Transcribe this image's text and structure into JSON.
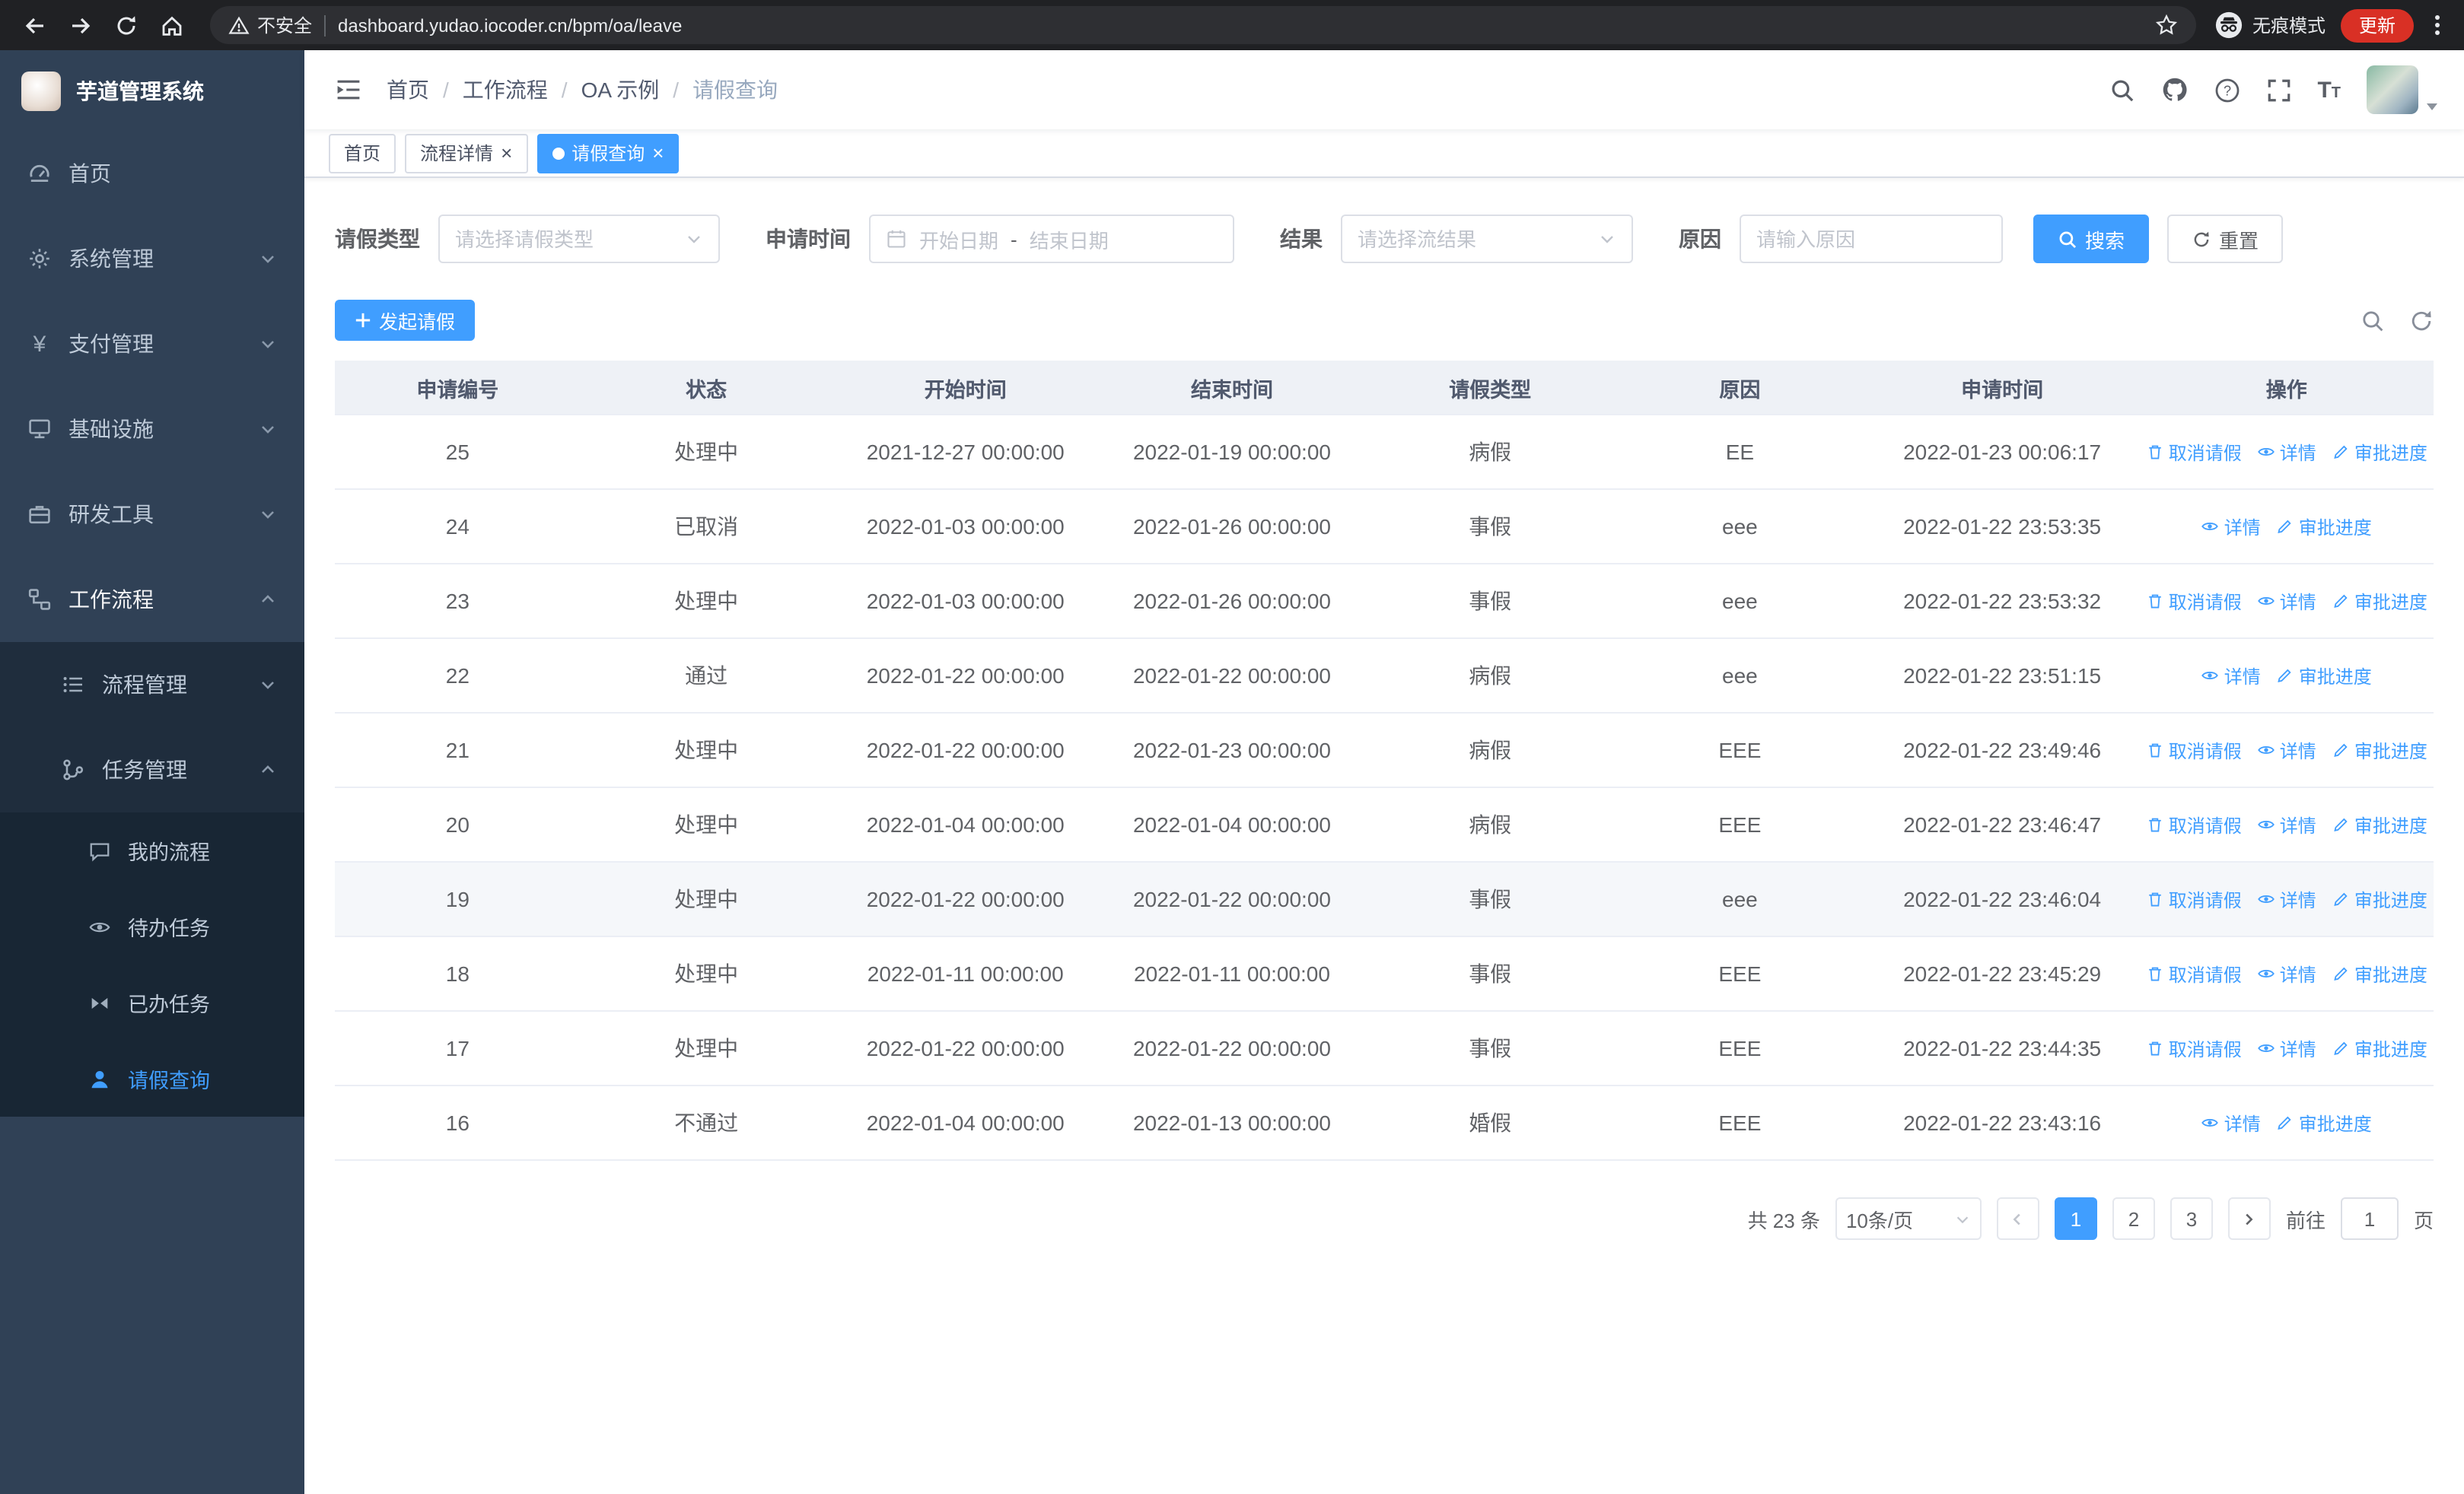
{
  "colors": {
    "primary": "#409eff",
    "sidebar_bg": "#304156",
    "sidebar_submenu_bg": "#1f2d3d",
    "active_tab_bg": "#409eff",
    "update_pill_bg": "#d93025",
    "table_header_bg": "#eef1f6"
  },
  "browser": {
    "security_label": "不安全",
    "url": "dashboard.yudao.iocoder.cn/bpm/oa/leave",
    "incognito_label": "无痕模式",
    "update_label": "更新"
  },
  "sidebar": {
    "title": "芋道管理系统",
    "items": [
      {
        "label": "首页"
      },
      {
        "label": "系统管理"
      },
      {
        "label": "支付管理"
      },
      {
        "label": "基础设施"
      },
      {
        "label": "研发工具"
      },
      {
        "label": "工作流程"
      }
    ],
    "workflow_children": [
      {
        "label": "流程管理"
      },
      {
        "label": "任务管理"
      }
    ],
    "task_children": [
      {
        "label": "我的流程"
      },
      {
        "label": "待办任务"
      },
      {
        "label": "已办任务"
      },
      {
        "label": "请假查询"
      }
    ]
  },
  "breadcrumb": [
    "首页",
    "工作流程",
    "OA 示例",
    "请假查询"
  ],
  "tabs": [
    {
      "label": "首页"
    },
    {
      "label": "流程详情"
    },
    {
      "label": "请假查询"
    }
  ],
  "filters": {
    "leave_type_label": "请假类型",
    "leave_type_placeholder": "请选择请假类型",
    "apply_time_label": "申请时间",
    "start_placeholder": "开始日期",
    "separator": "-",
    "end_placeholder": "结束日期",
    "result_label": "结果",
    "result_placeholder": "请选择流结果",
    "reason_label": "原因",
    "reason_placeholder": "请输入原因",
    "search_label": "搜索",
    "reset_label": "重置"
  },
  "toolbar": {
    "create_label": "发起请假"
  },
  "table": {
    "columns": [
      "申请编号",
      "状态",
      "开始时间",
      "结束时间",
      "请假类型",
      "原因",
      "申请时间",
      "操作"
    ],
    "actions": {
      "cancel": "取消请假",
      "detail": "详情",
      "progress": "审批进度"
    },
    "rows": [
      {
        "id": "25",
        "status": "处理中",
        "start": "2021-12-27 00:00:00",
        "end": "2022-01-19 00:00:00",
        "type": "病假",
        "reason": "EE",
        "applied": "2022-01-23 00:06:17",
        "cancellable": true,
        "highlighted": false
      },
      {
        "id": "24",
        "status": "已取消",
        "start": "2022-01-03 00:00:00",
        "end": "2022-01-26 00:00:00",
        "type": "事假",
        "reason": "eee",
        "applied": "2022-01-22 23:53:35",
        "cancellable": false,
        "highlighted": false
      },
      {
        "id": "23",
        "status": "处理中",
        "start": "2022-01-03 00:00:00",
        "end": "2022-01-26 00:00:00",
        "type": "事假",
        "reason": "eee",
        "applied": "2022-01-22 23:53:32",
        "cancellable": true,
        "highlighted": false
      },
      {
        "id": "22",
        "status": "通过",
        "start": "2022-01-22 00:00:00",
        "end": "2022-01-22 00:00:00",
        "type": "病假",
        "reason": "eee",
        "applied": "2022-01-22 23:51:15",
        "cancellable": false,
        "highlighted": false
      },
      {
        "id": "21",
        "status": "处理中",
        "start": "2022-01-22 00:00:00",
        "end": "2022-01-23 00:00:00",
        "type": "病假",
        "reason": "EEE",
        "applied": "2022-01-22 23:49:46",
        "cancellable": true,
        "highlighted": false
      },
      {
        "id": "20",
        "status": "处理中",
        "start": "2022-01-04 00:00:00",
        "end": "2022-01-04 00:00:00",
        "type": "病假",
        "reason": "EEE",
        "applied": "2022-01-22 23:46:47",
        "cancellable": true,
        "highlighted": false
      },
      {
        "id": "19",
        "status": "处理中",
        "start": "2022-01-22 00:00:00",
        "end": "2022-01-22 00:00:00",
        "type": "事假",
        "reason": "eee",
        "applied": "2022-01-22 23:46:04",
        "cancellable": true,
        "highlighted": true
      },
      {
        "id": "18",
        "status": "处理中",
        "start": "2022-01-11 00:00:00",
        "end": "2022-01-11 00:00:00",
        "type": "事假",
        "reason": "EEE",
        "applied": "2022-01-22 23:45:29",
        "cancellable": true,
        "highlighted": false
      },
      {
        "id": "17",
        "status": "处理中",
        "start": "2022-01-22 00:00:00",
        "end": "2022-01-22 00:00:00",
        "type": "事假",
        "reason": "EEE",
        "applied": "2022-01-22 23:44:35",
        "cancellable": true,
        "highlighted": false
      },
      {
        "id": "16",
        "status": "不通过",
        "start": "2022-01-04 00:00:00",
        "end": "2022-01-13 00:00:00",
        "type": "婚假",
        "reason": "EEE",
        "applied": "2022-01-22 23:43:16",
        "cancellable": false,
        "highlighted": false
      }
    ]
  },
  "pagination": {
    "total": "共 23 条",
    "page_size": "10条/页",
    "pages": [
      "1",
      "2",
      "3"
    ],
    "goto_label": "前往",
    "goto_value": "1",
    "unit_label": "页"
  }
}
